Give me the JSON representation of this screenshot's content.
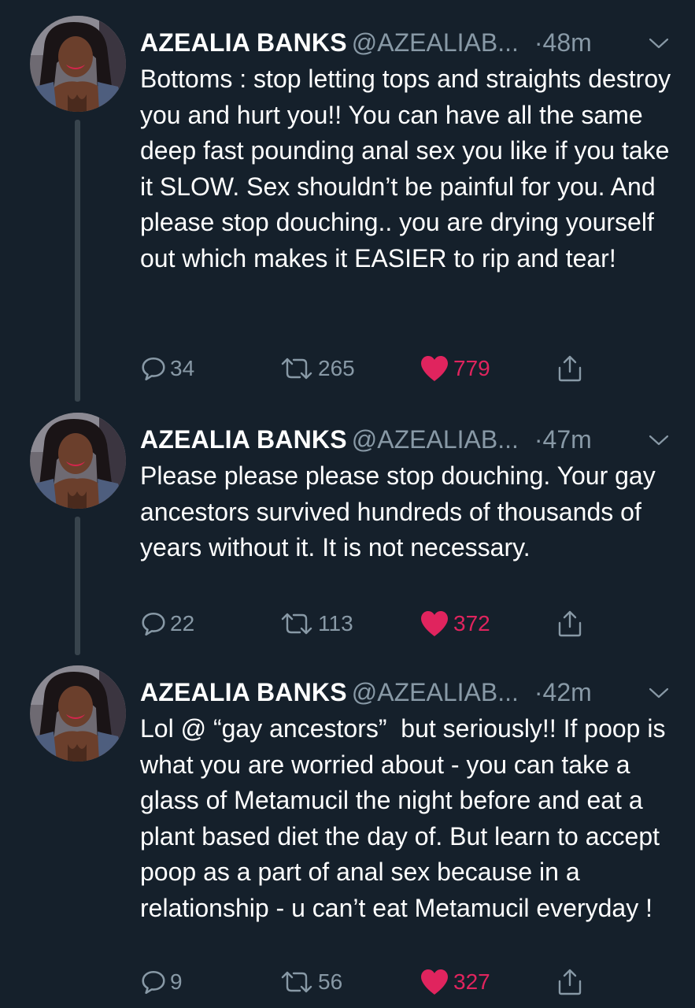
{
  "colors": {
    "background": "#15202b",
    "text_primary": "#ffffff",
    "text_secondary": "#8899a6",
    "like_active": "#e0245e",
    "thread_line": "#38444d"
  },
  "icons": {
    "reply": "comment-bubble-icon",
    "retweet": "retweet-arrows-icon",
    "like": "heart-filled-icon",
    "share": "share-upload-icon",
    "menu": "chevron-down-icon"
  },
  "tweets": [
    {
      "name": "AZEALIA BANKS",
      "handle": "@AZEALIAB...",
      "dot": "·",
      "time": "48m",
      "text": "Bottoms : stop letting tops and straights destroy you and hurt you!! You can have all the same deep fast pounding anal sex you like if you take it SLOW. Sex shouldn’t be painful for you. And please stop douching.. you are drying yourself out which makes it EASIER to rip and tear!",
      "replies": "34",
      "retweets": "265",
      "likes": "779",
      "liked": true
    },
    {
      "name": "AZEALIA BANKS",
      "handle": "@AZEALIAB...",
      "dot": "·",
      "time": "47m",
      "text": "Please please please stop douching. Your gay ancestors survived hundreds of thousands of years without it. It is not necessary.",
      "replies": "22",
      "retweets": "113",
      "likes": "372",
      "liked": true
    },
    {
      "name": "AZEALIA BANKS",
      "handle": "@AZEALIAB...",
      "dot": "·",
      "time": "42m",
      "text": "Lol @ “gay ancestors”  but seriously!! If poop is what you are worried about - you can take a glass of Metamucil the night before and eat a plant based diet the day of. But learn to accept poop as a part of anal sex because in a relationship - u can’t eat Metamucil everyday !",
      "replies": "9",
      "retweets": "56",
      "likes": "327",
      "liked": true
    }
  ]
}
